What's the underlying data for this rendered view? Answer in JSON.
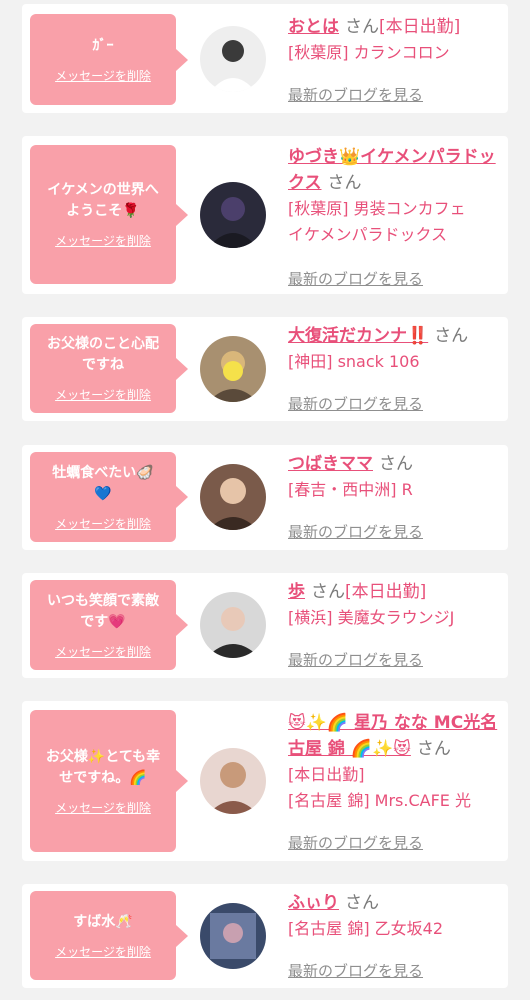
{
  "delete_label": "メッセージを削除",
  "blog_label": "最新のブログを見る",
  "honorific": "さん",
  "cards": [
    {
      "message": "ｶﾞｰ",
      "name": "おとは",
      "name_tag": "[本日出勤]",
      "meta": [
        "[秋葉原] カランコロン"
      ],
      "avatar_icon": "person-photo-icon"
    },
    {
      "message": "イケメンの世界へ\nようこそ🌹",
      "name": "ゆづき👑イケメンパラドックス",
      "name_tag": "",
      "meta": [
        "[秋葉原] 男装コンカフェ",
        "イケメンパラドックス"
      ],
      "avatar_icon": "person-photo-icon"
    },
    {
      "message": "お父様のこと心配\nですね",
      "name": "大復活だカンナ‼️",
      "name_tag": "",
      "meta": [
        "[神田] snack 106"
      ],
      "avatar_icon": "person-photo-icon"
    },
    {
      "message": "牡蠣食べたい🦪\n💙",
      "name": "つばきママ",
      "name_tag": "",
      "meta": [
        "[春吉・西中洲] R"
      ],
      "avatar_icon": "person-photo-icon"
    },
    {
      "message": "いつも笑顔で素敵\nです💗",
      "name": "歩",
      "name_tag": "[本日出勤]",
      "meta": [
        "[横浜] 美魔女ラウンジJ"
      ],
      "avatar_icon": "person-photo-icon"
    },
    {
      "message": "お父様✨とても幸\nせですね。🌈",
      "name": "😻✨🌈 星乃 なな MC光名古屋 錦 🌈✨😻",
      "name_tag": "",
      "meta": [
        "[本日出勤]",
        "[名古屋 錦] Mrs.CAFE 光"
      ],
      "avatar_icon": "person-photo-icon"
    },
    {
      "message": "すば水🥂",
      "name": "ふぃり",
      "name_tag": "",
      "meta": [
        "[名古屋 錦] 乙女坂42"
      ],
      "avatar_icon": "person-photo-icon"
    }
  ]
}
